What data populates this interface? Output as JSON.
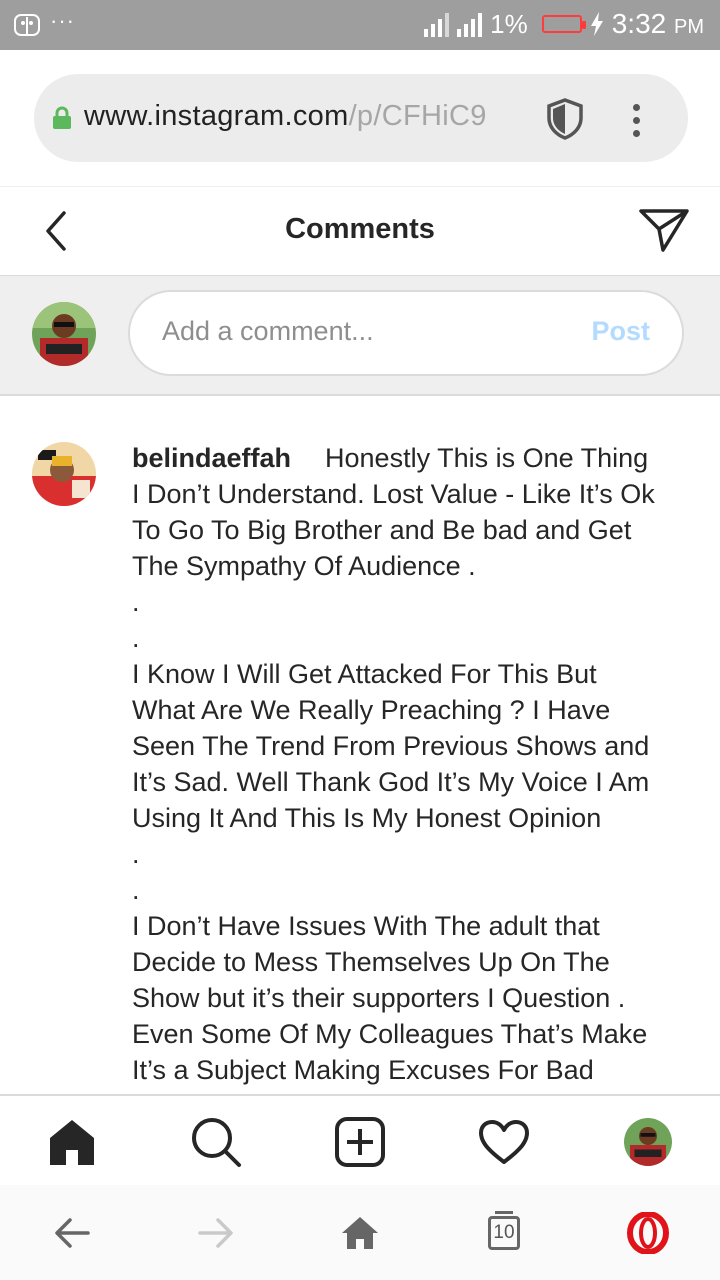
{
  "status_bar": {
    "notification_dots": "···",
    "battery_percent": "1%",
    "time": "3:32",
    "ampm": "PM",
    "battery_color": "#ff3b3b"
  },
  "browser": {
    "url_host": "www.instagram.com",
    "url_path": "/p/CFHiC9",
    "icons": [
      "lock-icon",
      "shield-icon",
      "more-vertical-icon"
    ]
  },
  "header": {
    "title": "Comments",
    "icons": [
      "back-chevron-icon",
      "send-direct-icon"
    ]
  },
  "compose": {
    "placeholder": "Add a comment...",
    "post_label": "Post",
    "post_color": "#b3dbff"
  },
  "comment": {
    "username": "belindaeffah",
    "lines": [
      "Honestly This is One Thing",
      "I Don’t Understand. Lost Value - Like It’s Ok",
      "To Go To Big Brother and Be bad and Get",
      "The Sympathy Of Audience .",
      ".",
      ".",
      "I Know I Will Get Attacked For This But",
      "What Are We Really Preaching ? I Have",
      "Seen The Trend From Previous Shows and",
      "It’s Sad. Well Thank God It’s My Voice I Am",
      "Using It And This Is My Honest Opinion",
      ".",
      ".",
      "I Don’t Have Issues With The adult that",
      "Decide to Mess Themselves Up On The",
      "Show but it’s their supporters I Question .",
      "Even Some Of My Colleagues That’s Make",
      "It’s a Subject Making Excuses For Bad"
    ]
  },
  "ig_nav": {
    "icons": [
      "home-icon",
      "search-icon",
      "new-post-icon",
      "activity-heart-icon",
      "profile-avatar"
    ]
  },
  "browser_nav": {
    "tab_count": "10",
    "icons": [
      "back-arrow-icon",
      "forward-arrow-icon",
      "home-icon",
      "tabs-icon",
      "opera-icon"
    ],
    "opera_color": "#e0131a"
  }
}
